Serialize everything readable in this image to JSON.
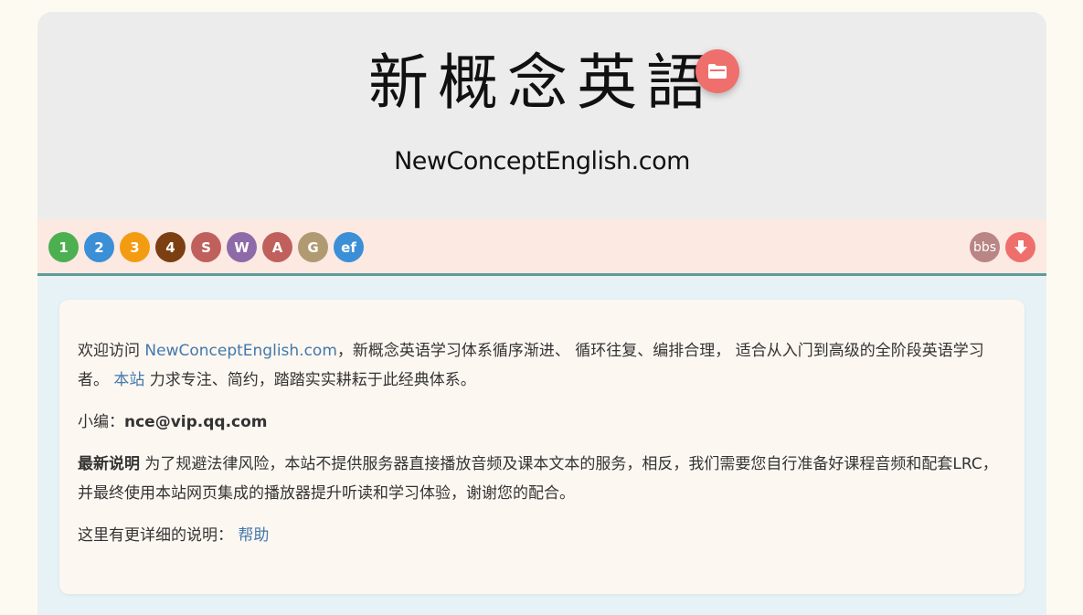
{
  "header": {
    "logo_cn": "新概念英語",
    "logo_en": "NewConceptEnglish.com",
    "folder_icon": "folder-icon",
    "folder_color": "#ef6f6c"
  },
  "nav": {
    "items": [
      {
        "label": "1",
        "color": "#4caf50"
      },
      {
        "label": "2",
        "color": "#3a8fd6"
      },
      {
        "label": "3",
        "color": "#f39c12"
      },
      {
        "label": "4",
        "color": "#7b3f12"
      },
      {
        "label": "S",
        "color": "#c0605c"
      },
      {
        "label": "W",
        "color": "#8e6aa8"
      },
      {
        "label": "A",
        "color": "#c0605c"
      },
      {
        "label": "G",
        "color": "#b09a72"
      },
      {
        "label": "ef",
        "color": "#3a8fd6"
      }
    ],
    "bbs_label": "bbs",
    "bbs_color": "#b98585",
    "download_icon": "download-arrow-icon",
    "download_color": "#ef6f6c"
  },
  "content": {
    "welcome_prefix": "欢迎访问 ",
    "welcome_link": "NewConceptEnglish.com",
    "welcome_suffix": "，新概念英语学习体系循序渐进、 循环往复、编排合理， 适合从入门到高级的全阶段英语学习者。 ",
    "site_link": "本站",
    "site_suffix": " 力求专注、简约，踏踏实实耕耘于此经典体系。",
    "editor_label": "小编：",
    "editor_email": "nce@vip.qq.com",
    "notice_title": "最新说明",
    "notice_text": " 为了规避法律风险，本站不提供服务器直接播放音频及课本文本的服务，相反，我们需要您自行准备好课程音频和配套LRC，并最终使用本站网页集成的播放器提升听读和学习体验，谢谢您的配合。",
    "help_prefix": "这里有更详细的说明： ",
    "help_link": "帮助"
  }
}
